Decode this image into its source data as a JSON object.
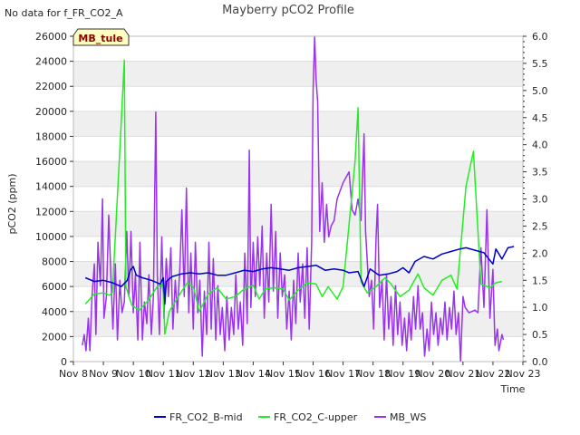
{
  "notice": "No data for f_FR_CO2_A",
  "tag": "MB_tule",
  "colors": {
    "band": "#efefef",
    "grid": "#dddddd",
    "tag_fill": "#ffffc0",
    "tag_text": "#8b0000"
  },
  "chart_data": {
    "type": "line",
    "title": "Mayberry pCO2 Profile",
    "xlabel": "Time",
    "ylabel": "pCO2 (ppm)",
    "y2label": "",
    "xlim": [
      8,
      23
    ],
    "ylim": [
      0,
      26000
    ],
    "y2lim": [
      0,
      6
    ],
    "x_ticks": [
      "Nov 8",
      "Nov 9",
      "Nov 10",
      "Nov 11",
      "Nov 12",
      "Nov 13",
      "Nov 14",
      "Nov 15",
      "Nov 16",
      "Nov 17",
      "Nov 18",
      "Nov 19",
      "Nov 20",
      "Nov 21",
      "Nov 22",
      "Nov 23"
    ],
    "y_ticks": [
      "0",
      "2000",
      "4000",
      "6000",
      "8000",
      "10000",
      "12000",
      "14000",
      "16000",
      "18000",
      "20000",
      "22000",
      "24000",
      "26000"
    ],
    "y2_ticks": [
      "0.0",
      "0.5",
      "1.0",
      "1.5",
      "2.0",
      "2.5",
      "3.0",
      "3.5",
      "4.0",
      "4.5",
      "5.0",
      "5.5",
      "6.0"
    ],
    "legend_position": "bottom-center",
    "grid": true,
    "series": [
      {
        "name": "FR_CO2_B-mid",
        "color": "#0000cc",
        "axis": "left",
        "points": [
          [
            8.4,
            6700
          ],
          [
            8.7,
            6400
          ],
          [
            9.0,
            6500
          ],
          [
            9.3,
            6300
          ],
          [
            9.6,
            6000
          ],
          [
            9.8,
            6500
          ],
          [
            9.9,
            7300
          ],
          [
            10.0,
            7600
          ],
          [
            10.1,
            6900
          ],
          [
            10.3,
            6700
          ],
          [
            10.6,
            6500
          ],
          [
            10.9,
            6200
          ],
          [
            11.0,
            6700
          ],
          [
            11.05,
            4600
          ],
          [
            11.1,
            6400
          ],
          [
            11.3,
            6800
          ],
          [
            11.6,
            7000
          ],
          [
            11.9,
            7100
          ],
          [
            12.2,
            7000
          ],
          [
            12.5,
            7100
          ],
          [
            12.8,
            6900
          ],
          [
            13.1,
            6900
          ],
          [
            13.4,
            7100
          ],
          [
            13.7,
            7300
          ],
          [
            14.0,
            7200
          ],
          [
            14.3,
            7400
          ],
          [
            14.6,
            7500
          ],
          [
            14.9,
            7400
          ],
          [
            15.2,
            7300
          ],
          [
            15.5,
            7500
          ],
          [
            15.8,
            7600
          ],
          [
            16.1,
            7700
          ],
          [
            16.4,
            7300
          ],
          [
            16.7,
            7400
          ],
          [
            17.0,
            7300
          ],
          [
            17.2,
            7100
          ],
          [
            17.5,
            7200
          ],
          [
            17.7,
            6000
          ],
          [
            17.9,
            7400
          ],
          [
            18.2,
            6900
          ],
          [
            18.5,
            7000
          ],
          [
            18.8,
            7200
          ],
          [
            19.0,
            7500
          ],
          [
            19.2,
            7100
          ],
          [
            19.4,
            8000
          ],
          [
            19.7,
            8400
          ],
          [
            20.0,
            8200
          ],
          [
            20.3,
            8600
          ],
          [
            20.6,
            8800
          ],
          [
            20.9,
            9000
          ],
          [
            21.1,
            9100
          ],
          [
            21.4,
            8900
          ],
          [
            21.7,
            8700
          ],
          [
            21.9,
            8100
          ],
          [
            22.0,
            7800
          ],
          [
            22.1,
            9000
          ],
          [
            22.3,
            8200
          ],
          [
            22.5,
            9100
          ],
          [
            22.7,
            9200
          ]
        ]
      },
      {
        "name": "FR_CO2_C-upper",
        "color": "#22ee22",
        "axis": "left",
        "points": [
          [
            8.4,
            4600
          ],
          [
            8.7,
            5400
          ],
          [
            9.0,
            5500
          ],
          [
            9.2,
            5300
          ],
          [
            9.3,
            5500
          ],
          [
            9.55,
            17000
          ],
          [
            9.7,
            24100
          ],
          [
            9.75,
            6000
          ],
          [
            9.95,
            4500
          ],
          [
            10.2,
            4100
          ],
          [
            10.5,
            4900
          ],
          [
            10.8,
            6000
          ],
          [
            10.95,
            6200
          ],
          [
            11.0,
            5500
          ],
          [
            11.05,
            2200
          ],
          [
            11.2,
            4000
          ],
          [
            11.5,
            5200
          ],
          [
            11.8,
            6300
          ],
          [
            12.0,
            6000
          ],
          [
            12.2,
            4000
          ],
          [
            12.5,
            5400
          ],
          [
            12.8,
            5900
          ],
          [
            13.1,
            5000
          ],
          [
            13.4,
            5200
          ],
          [
            13.7,
            5800
          ],
          [
            14.0,
            6100
          ],
          [
            14.2,
            5000
          ],
          [
            14.4,
            5800
          ],
          [
            14.7,
            5900
          ],
          [
            15.0,
            5800
          ],
          [
            15.2,
            4900
          ],
          [
            15.5,
            5700
          ],
          [
            15.8,
            6300
          ],
          [
            16.1,
            6200
          ],
          [
            16.3,
            5200
          ],
          [
            16.5,
            6000
          ],
          [
            16.8,
            5000
          ],
          [
            17.0,
            6000
          ],
          [
            17.4,
            16000
          ],
          [
            17.5,
            20300
          ],
          [
            17.6,
            6400
          ],
          [
            17.8,
            5500
          ],
          [
            18.1,
            6000
          ],
          [
            18.4,
            6700
          ],
          [
            18.6,
            6200
          ],
          [
            18.9,
            5200
          ],
          [
            19.2,
            5700
          ],
          [
            19.5,
            7000
          ],
          [
            19.7,
            5900
          ],
          [
            20.0,
            5300
          ],
          [
            20.3,
            6500
          ],
          [
            20.6,
            6900
          ],
          [
            20.8,
            5800
          ],
          [
            21.1,
            14000
          ],
          [
            21.35,
            16800
          ],
          [
            21.6,
            6200
          ],
          [
            21.9,
            5900
          ],
          [
            22.1,
            6300
          ],
          [
            22.3,
            6400
          ]
        ]
      },
      {
        "name": "MB_WS",
        "color": "#9933ee",
        "axis": "right",
        "points": [
          [
            8.3,
            0.3
          ],
          [
            8.36,
            0.5
          ],
          [
            8.42,
            0.2
          ],
          [
            8.5,
            0.8
          ],
          [
            8.55,
            0.2
          ],
          [
            8.62,
            1.2
          ],
          [
            8.7,
            1.8
          ],
          [
            8.75,
            0.5
          ],
          [
            8.82,
            2.2
          ],
          [
            8.9,
            1.4
          ],
          [
            8.97,
            3.0
          ],
          [
            9.02,
            0.8
          ],
          [
            9.1,
            1.2
          ],
          [
            9.18,
            2.7
          ],
          [
            9.25,
            1.6
          ],
          [
            9.32,
            0.6
          ],
          [
            9.4,
            1.8
          ],
          [
            9.47,
            0.4
          ],
          [
            9.55,
            1.5
          ],
          [
            9.62,
            0.9
          ],
          [
            9.7,
            1.1
          ],
          [
            9.78,
            2.4
          ],
          [
            9.85,
            1.2
          ],
          [
            9.92,
            2.4
          ],
          [
            10.0,
            0.9
          ],
          [
            10.07,
            1.6
          ],
          [
            10.15,
            0.4
          ],
          [
            10.22,
            2.2
          ],
          [
            10.3,
            0.4
          ],
          [
            10.37,
            1.1
          ],
          [
            10.45,
            0.7
          ],
          [
            10.52,
            1.6
          ],
          [
            10.6,
            0.5
          ],
          [
            10.67,
            1.2
          ],
          [
            10.75,
            4.6
          ],
          [
            10.8,
            1.6
          ],
          [
            10.87,
            0.5
          ],
          [
            10.95,
            2.3
          ],
          [
            11.02,
            0.8
          ],
          [
            11.1,
            1.9
          ],
          [
            11.17,
            1.2
          ],
          [
            11.25,
            2.1
          ],
          [
            11.32,
            0.6
          ],
          [
            11.4,
            1.5
          ],
          [
            11.47,
            0.9
          ],
          [
            11.55,
            1.7
          ],
          [
            11.62,
            2.8
          ],
          [
            11.7,
            1.2
          ],
          [
            11.77,
            3.2
          ],
          [
            11.85,
            0.9
          ],
          [
            11.92,
            2.0
          ],
          [
            12.0,
            0.6
          ],
          [
            12.07,
            2.2
          ],
          [
            12.15,
            0.9
          ],
          [
            12.22,
            1.5
          ],
          [
            12.3,
            0.1
          ],
          [
            12.37,
            1.3
          ],
          [
            12.45,
            0.5
          ],
          [
            12.52,
            2.2
          ],
          [
            12.6,
            0.6
          ],
          [
            12.67,
            1.9
          ],
          [
            12.75,
            0.4
          ],
          [
            12.82,
            1.4
          ],
          [
            12.9,
            0.5
          ],
          [
            12.97,
            1.0
          ],
          [
            13.05,
            0.2
          ],
          [
            13.12,
            1.2
          ],
          [
            13.2,
            0.4
          ],
          [
            13.27,
            1.0
          ],
          [
            13.35,
            0.5
          ],
          [
            13.42,
            1.6
          ],
          [
            13.5,
            0.6
          ],
          [
            13.57,
            1.1
          ],
          [
            13.65,
            0.3
          ],
          [
            13.72,
            2.0
          ],
          [
            13.8,
            0.7
          ],
          [
            13.87,
            3.9
          ],
          [
            13.92,
            1.0
          ],
          [
            14.0,
            2.2
          ],
          [
            14.07,
            1.2
          ],
          [
            14.15,
            2.3
          ],
          [
            14.22,
            1.4
          ],
          [
            14.3,
            2.5
          ],
          [
            14.37,
            0.8
          ],
          [
            14.45,
            2.0
          ],
          [
            14.52,
            1.1
          ],
          [
            14.6,
            2.9
          ],
          [
            14.67,
            1.3
          ],
          [
            14.75,
            2.4
          ],
          [
            14.82,
            0.8
          ],
          [
            14.9,
            2.0
          ],
          [
            14.97,
            1.2
          ],
          [
            15.05,
            1.6
          ],
          [
            15.12,
            0.6
          ],
          [
            15.2,
            1.3
          ],
          [
            15.27,
            0.4
          ],
          [
            15.35,
            1.5
          ],
          [
            15.42,
            0.7
          ],
          [
            15.5,
            2.0
          ],
          [
            15.57,
            1.1
          ],
          [
            15.65,
            1.8
          ],
          [
            15.72,
            0.8
          ],
          [
            15.8,
            2.1
          ],
          [
            15.87,
            0.6
          ],
          [
            15.95,
            2.2
          ],
          [
            16.0,
            5.0
          ],
          [
            16.05,
            6.0
          ],
          [
            16.1,
            5.2
          ],
          [
            16.15,
            4.8
          ],
          [
            16.22,
            2.4
          ],
          [
            16.3,
            3.3
          ],
          [
            16.37,
            2.2
          ],
          [
            16.45,
            2.9
          ],
          [
            16.52,
            2.3
          ],
          [
            16.6,
            2.5
          ],
          [
            16.7,
            2.6
          ],
          [
            16.8,
            3.0
          ],
          [
            17.0,
            3.3
          ],
          [
            17.2,
            3.5
          ],
          [
            17.3,
            2.8
          ],
          [
            17.4,
            2.7
          ],
          [
            17.5,
            3.0
          ],
          [
            17.6,
            2.6
          ],
          [
            17.7,
            4.2
          ],
          [
            17.75,
            2.4
          ],
          [
            17.8,
            1.9
          ],
          [
            17.87,
            1.2
          ],
          [
            17.95,
            1.5
          ],
          [
            18.02,
            0.6
          ],
          [
            18.1,
            2.3
          ],
          [
            18.15,
            2.9
          ],
          [
            18.22,
            1.0
          ],
          [
            18.3,
            1.5
          ],
          [
            18.37,
            0.4
          ],
          [
            18.45,
            1.6
          ],
          [
            18.52,
            0.6
          ],
          [
            18.6,
            1.2
          ],
          [
            18.67,
            0.3
          ],
          [
            18.75,
            1.4
          ],
          [
            18.82,
            0.5
          ],
          [
            18.9,
            1.1
          ],
          [
            18.97,
            0.3
          ],
          [
            19.05,
            0.8
          ],
          [
            19.12,
            0.2
          ],
          [
            19.2,
            0.9
          ],
          [
            19.27,
            0.4
          ],
          [
            19.35,
            1.2
          ],
          [
            19.42,
            0.6
          ],
          [
            19.5,
            1.4
          ],
          [
            19.57,
            0.6
          ],
          [
            19.65,
            0.9
          ],
          [
            19.72,
            0.1
          ],
          [
            19.8,
            0.6
          ],
          [
            19.87,
            0.2
          ],
          [
            19.95,
            1.1
          ],
          [
            20.02,
            0.5
          ],
          [
            20.1,
            0.9
          ],
          [
            20.17,
            0.3
          ],
          [
            20.25,
            0.8
          ],
          [
            20.32,
            0.5
          ],
          [
            20.4,
            1.1
          ],
          [
            20.47,
            0.4
          ],
          [
            20.55,
            1.0
          ],
          [
            20.62,
            0.6
          ],
          [
            20.7,
            1.3
          ],
          [
            20.77,
            0.5
          ],
          [
            20.85,
            0.9
          ],
          [
            20.92,
            0.0
          ],
          [
            21.0,
            1.2
          ],
          [
            21.07,
            1.0
          ],
          [
            21.2,
            0.9
          ],
          [
            21.4,
            0.95
          ],
          [
            21.5,
            0.9
          ],
          [
            21.6,
            2.1
          ],
          [
            21.7,
            1.0
          ],
          [
            21.8,
            2.8
          ],
          [
            21.9,
            0.8
          ],
          [
            22.0,
            1.7
          ],
          [
            22.07,
            0.3
          ],
          [
            22.15,
            0.6
          ],
          [
            22.2,
            0.2
          ],
          [
            22.3,
            0.5
          ],
          [
            22.35,
            0.4
          ]
        ]
      }
    ]
  }
}
